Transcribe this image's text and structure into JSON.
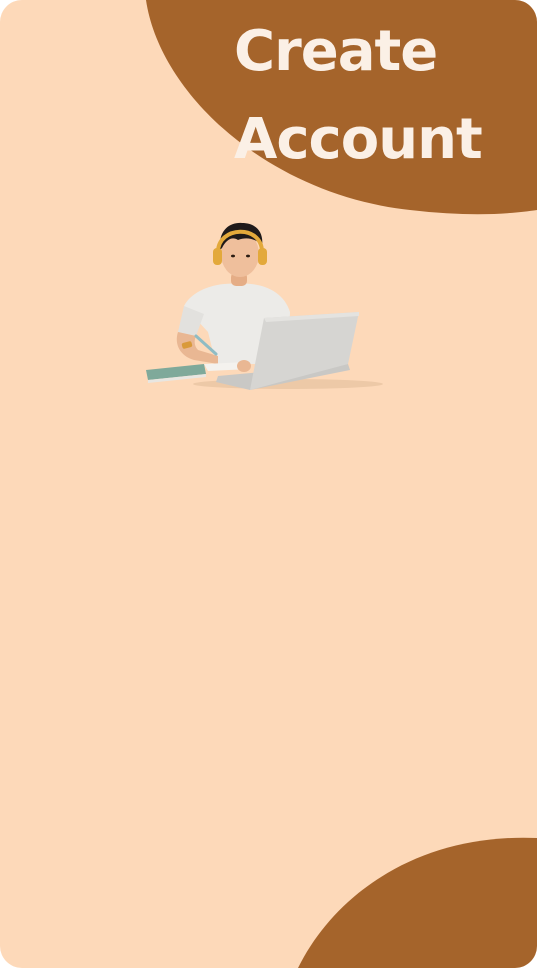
{
  "header": {
    "title_line1": "Create",
    "title_line2": "Account"
  },
  "illustration": {
    "description_icon": "person-with-laptop-illustration"
  },
  "colors": {
    "background": "#fdd9b9",
    "accent": "#a5642b",
    "title_text": "#fbf0e6"
  }
}
